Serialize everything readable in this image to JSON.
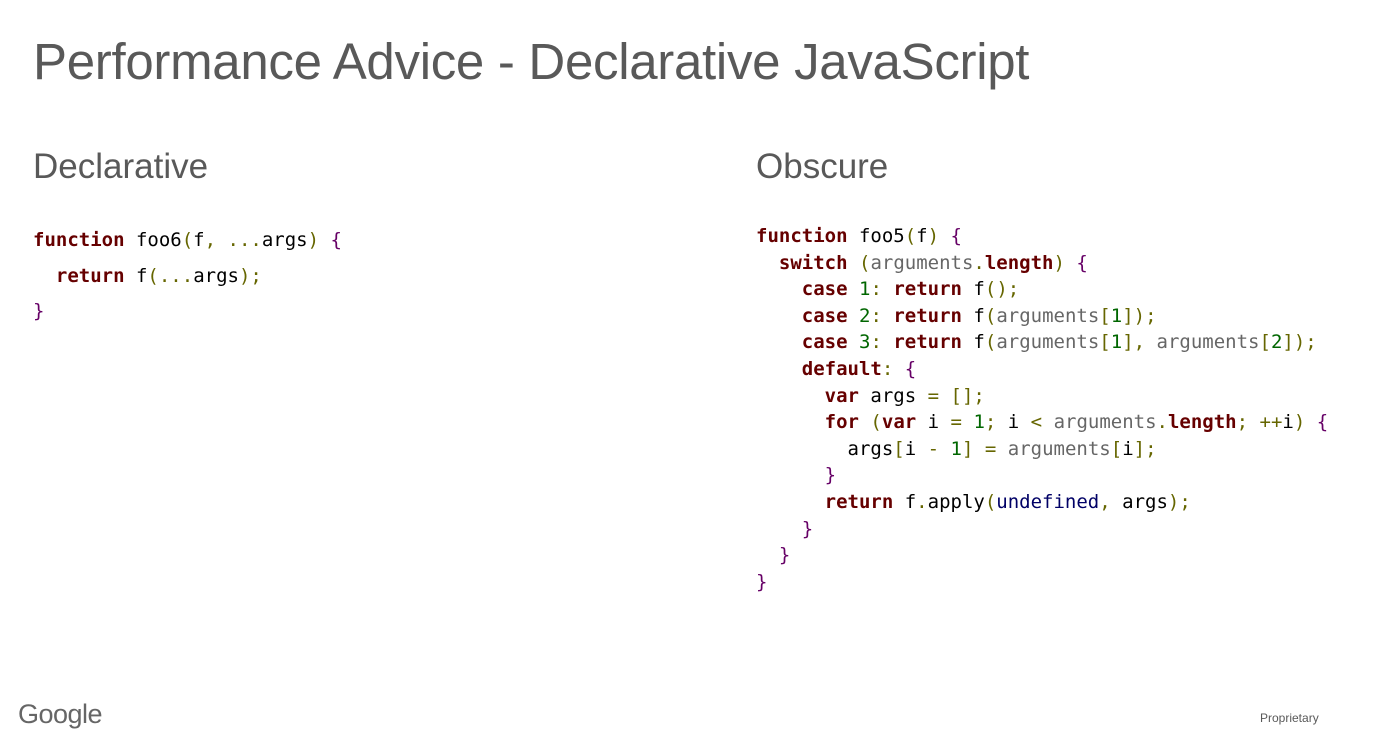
{
  "slide": {
    "title": "Performance Advice - Declarative JavaScript"
  },
  "columns": {
    "left": {
      "heading": "Declarative",
      "code": [
        [
          [
            "kw",
            "function"
          ],
          [
            "plain",
            " foo6"
          ],
          [
            "punc",
            "("
          ],
          [
            "plain",
            "f"
          ],
          [
            "punc",
            ", ..."
          ],
          [
            "plain",
            "args"
          ],
          [
            "punc",
            ")"
          ],
          [
            "plain",
            " "
          ],
          [
            "brace",
            "{"
          ]
        ],
        [
          [
            "plain",
            "  "
          ],
          [
            "kw",
            "return"
          ],
          [
            "plain",
            " f"
          ],
          [
            "punc",
            "(..."
          ],
          [
            "plain",
            "args"
          ],
          [
            "punc",
            ");"
          ]
        ],
        [
          [
            "brace",
            "}"
          ]
        ]
      ]
    },
    "right": {
      "heading": "Obscure",
      "code": [
        [
          [
            "kw",
            "function"
          ],
          [
            "plain",
            " foo5"
          ],
          [
            "punc",
            "("
          ],
          [
            "plain",
            "f"
          ],
          [
            "punc",
            ")"
          ],
          [
            "plain",
            " "
          ],
          [
            "brace",
            "{"
          ]
        ],
        [
          [
            "plain",
            "  "
          ],
          [
            "kw",
            "switch"
          ],
          [
            "plain",
            " "
          ],
          [
            "punc",
            "("
          ],
          [
            "ident",
            "arguments"
          ],
          [
            "punc",
            "."
          ],
          [
            "kw",
            "length"
          ],
          [
            "punc",
            ")"
          ],
          [
            "plain",
            " "
          ],
          [
            "brace",
            "{"
          ]
        ],
        [
          [
            "plain",
            "    "
          ],
          [
            "kw",
            "case"
          ],
          [
            "plain",
            " "
          ],
          [
            "num",
            "1"
          ],
          [
            "punc",
            ":"
          ],
          [
            "plain",
            " "
          ],
          [
            "kw",
            "return"
          ],
          [
            "plain",
            " f"
          ],
          [
            "punc",
            "();"
          ]
        ],
        [
          [
            "plain",
            "    "
          ],
          [
            "kw",
            "case"
          ],
          [
            "plain",
            " "
          ],
          [
            "num",
            "2"
          ],
          [
            "punc",
            ":"
          ],
          [
            "plain",
            " "
          ],
          [
            "kw",
            "return"
          ],
          [
            "plain",
            " f"
          ],
          [
            "punc",
            "("
          ],
          [
            "ident",
            "arguments"
          ],
          [
            "punc",
            "["
          ],
          [
            "num",
            "1"
          ],
          [
            "punc",
            "]);"
          ]
        ],
        [
          [
            "plain",
            "    "
          ],
          [
            "kw",
            "case"
          ],
          [
            "plain",
            " "
          ],
          [
            "num",
            "3"
          ],
          [
            "punc",
            ":"
          ],
          [
            "plain",
            " "
          ],
          [
            "kw",
            "return"
          ],
          [
            "plain",
            " f"
          ],
          [
            "punc",
            "("
          ],
          [
            "ident",
            "arguments"
          ],
          [
            "punc",
            "["
          ],
          [
            "num",
            "1"
          ],
          [
            "punc",
            "],"
          ],
          [
            "plain",
            " "
          ],
          [
            "ident",
            "arguments"
          ],
          [
            "punc",
            "["
          ],
          [
            "num",
            "2"
          ],
          [
            "punc",
            "]);"
          ]
        ],
        [
          [
            "plain",
            "    "
          ],
          [
            "kw",
            "default"
          ],
          [
            "punc",
            ":"
          ],
          [
            "plain",
            " "
          ],
          [
            "brace",
            "{"
          ]
        ],
        [
          [
            "plain",
            "      "
          ],
          [
            "kw",
            "var"
          ],
          [
            "plain",
            " args "
          ],
          [
            "punc",
            "="
          ],
          [
            "plain",
            " "
          ],
          [
            "punc",
            "[];"
          ]
        ],
        [
          [
            "plain",
            "      "
          ],
          [
            "kw",
            "for"
          ],
          [
            "plain",
            " "
          ],
          [
            "punc",
            "("
          ],
          [
            "kw",
            "var"
          ],
          [
            "plain",
            " i "
          ],
          [
            "punc",
            "="
          ],
          [
            "plain",
            " "
          ],
          [
            "num",
            "1"
          ],
          [
            "punc",
            ";"
          ],
          [
            "plain",
            " i "
          ],
          [
            "punc",
            "<"
          ],
          [
            "plain",
            " "
          ],
          [
            "ident",
            "arguments"
          ],
          [
            "punc",
            "."
          ],
          [
            "kw",
            "length"
          ],
          [
            "punc",
            ";"
          ],
          [
            "plain",
            " "
          ],
          [
            "punc",
            "++"
          ],
          [
            "plain",
            "i"
          ],
          [
            "punc",
            ")"
          ],
          [
            "plain",
            " "
          ],
          [
            "brace",
            "{"
          ]
        ],
        [
          [
            "plain",
            "        args"
          ],
          [
            "punc",
            "["
          ],
          [
            "plain",
            "i "
          ],
          [
            "punc",
            "-"
          ],
          [
            "plain",
            " "
          ],
          [
            "num",
            "1"
          ],
          [
            "punc",
            "]"
          ],
          [
            "plain",
            " "
          ],
          [
            "punc",
            "="
          ],
          [
            "plain",
            " "
          ],
          [
            "ident",
            "arguments"
          ],
          [
            "punc",
            "["
          ],
          [
            "plain",
            "i"
          ],
          [
            "punc",
            "];"
          ]
        ],
        [
          [
            "plain",
            "      "
          ],
          [
            "brace",
            "}"
          ]
        ],
        [
          [
            "plain",
            "      "
          ],
          [
            "kw",
            "return"
          ],
          [
            "plain",
            " f"
          ],
          [
            "punc",
            "."
          ],
          [
            "plain",
            "apply"
          ],
          [
            "punc",
            "("
          ],
          [
            "lit",
            "undefined"
          ],
          [
            "punc",
            ","
          ],
          [
            "plain",
            " args"
          ],
          [
            "punc",
            ");"
          ]
        ],
        [
          [
            "plain",
            "    "
          ],
          [
            "brace",
            "}"
          ]
        ],
        [
          [
            "plain",
            "  "
          ],
          [
            "brace",
            "}"
          ]
        ],
        [
          [
            "brace",
            "}"
          ]
        ]
      ]
    }
  },
  "footer": {
    "logo_text": "Google",
    "label": "Proprietary"
  }
}
